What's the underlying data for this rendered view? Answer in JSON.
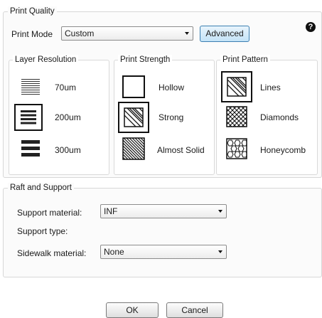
{
  "print_quality": {
    "title": "Print Quality",
    "print_mode_label": "Print Mode",
    "print_mode_value": "Custom",
    "advanced_label": "Advanced",
    "help_icon": "question-circle-icon",
    "layer_resolution": {
      "title": "Layer Resolution",
      "options": [
        {
          "label": "70um",
          "selected": false
        },
        {
          "label": "200um",
          "selected": true
        },
        {
          "label": "300um",
          "selected": false
        }
      ]
    },
    "print_strength": {
      "title": "Print Strength",
      "options": [
        {
          "label": "Hollow",
          "selected": false
        },
        {
          "label": "Strong",
          "selected": true
        },
        {
          "label": "Almost Solid",
          "selected": false
        }
      ]
    },
    "print_pattern": {
      "title": "Print Pattern",
      "options": [
        {
          "label": "Lines",
          "selected": true
        },
        {
          "label": "Diamonds",
          "selected": false
        },
        {
          "label": "Honeycomb",
          "selected": false
        }
      ]
    }
  },
  "raft_support": {
    "title": "Raft and Support",
    "support_material_label": "Support material:",
    "support_material_value": "INF",
    "support_type_label": "Support type:",
    "sidewalk_material_label": "Sidewalk material:",
    "sidewalk_material_value": "None"
  },
  "footer": {
    "ok_label": "OK",
    "cancel_label": "Cancel"
  }
}
